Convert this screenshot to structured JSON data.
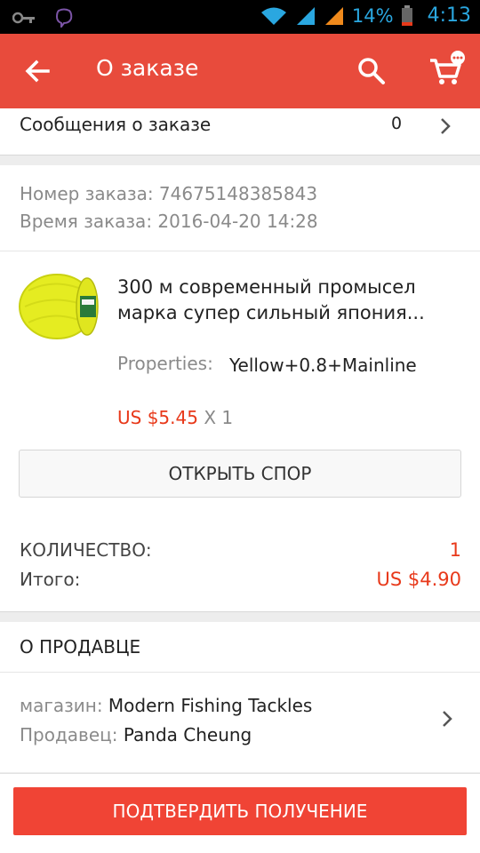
{
  "status_bar": {
    "battery": "14%",
    "time": "4:13",
    "icons": [
      "key-icon",
      "viber-icon",
      "wifi-icon",
      "signal-icon",
      "signal-icon",
      "battery-icon"
    ]
  },
  "app_bar": {
    "title": "О заказе",
    "icons": [
      "back-arrow-icon",
      "search-icon",
      "cart-icon"
    ]
  },
  "messages": {
    "label": "Сообщения о заказе",
    "count": "0"
  },
  "order_info": {
    "number": "Номер заказа: 74675148385843",
    "time": "Время заказа: 2016-04-20 14:28"
  },
  "product": {
    "title": "300 м современный промысел марка супер сильный япония...",
    "properties_label": "Properties:",
    "properties_value": "Yellow+0.8+Mainline",
    "price": "US $5.45",
    "quantity": "X 1",
    "dispute_button": "ОТКРЫТЬ СПОР"
  },
  "summary": {
    "quantity_label": "КОЛИЧЕСТВО:",
    "quantity_value": "1",
    "total_label": "Итого:",
    "total_value": "US $4.90"
  },
  "seller": {
    "header": "О ПРОДАВЦЕ",
    "store_label": "магазин:",
    "store_value": "Modern Fishing Tackles",
    "seller_label": "Продавец:",
    "seller_value": "Panda Cheung"
  },
  "confirm_button": "ПОДТВЕРДИТЬ ПОЛУЧЕНИЕ",
  "colors": {
    "primary": "#e84b3c",
    "price": "#e8391a",
    "status_icons": "#2aa7e0"
  }
}
